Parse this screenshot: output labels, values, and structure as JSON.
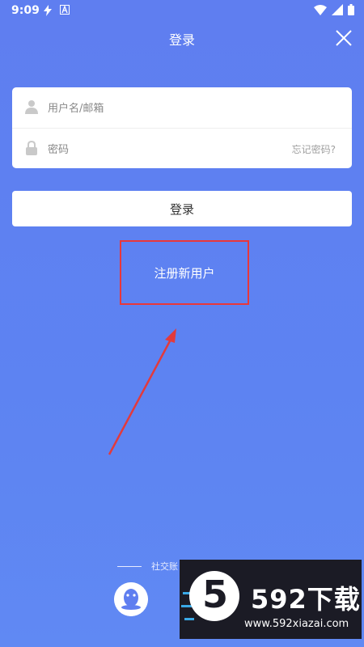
{
  "status_bar": {
    "time": "9:09"
  },
  "header": {
    "title": "登录"
  },
  "form": {
    "username_placeholder": "用户名/邮箱",
    "password_placeholder": "密码",
    "forgot_password": "忘记密码?"
  },
  "actions": {
    "login_label": "登录",
    "register_label": "注册新用户"
  },
  "social": {
    "label": "社交账"
  },
  "watermark": {
    "logo_number": "5",
    "brand": "592下载",
    "url": "www.592xiazai.com"
  },
  "colors": {
    "background": "#5f7ef0",
    "highlight_box": "#e9373a",
    "annotation_arrow": "#e23a3d"
  }
}
